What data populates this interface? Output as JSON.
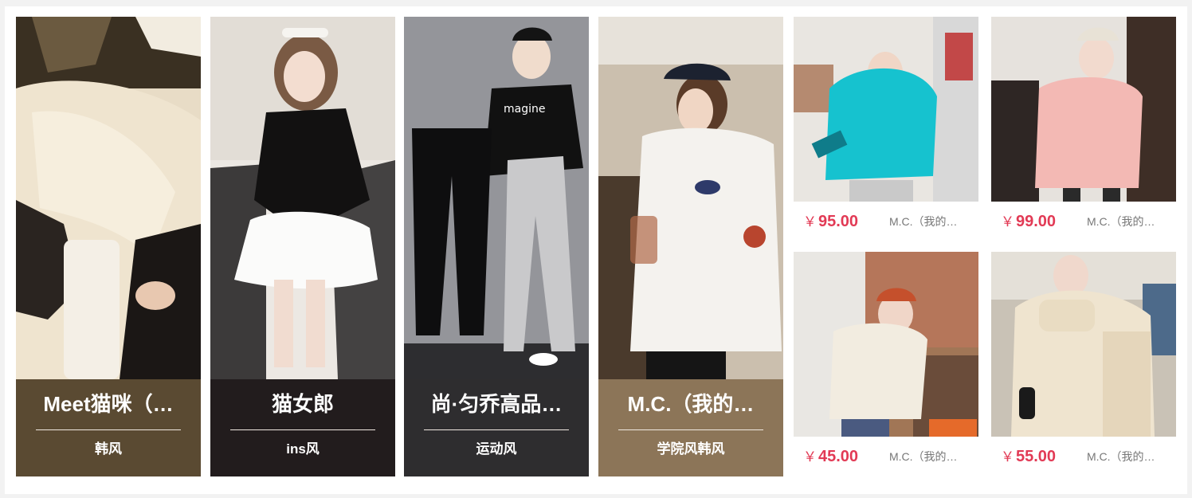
{
  "stores": [
    {
      "name": "Meet猫咪（…",
      "tag": "韩风",
      "color": "#5a4a32"
    },
    {
      "name": "猫女郎",
      "tag": "ins风",
      "color": "#221c1d"
    },
    {
      "name": "尚·匀乔高品…",
      "tag": "运动风",
      "color": "#2e2d2f"
    },
    {
      "name": "M.C.（我的…",
      "tag": "学院风韩风",
      "color": "#8c7558"
    }
  ],
  "products": [
    {
      "currency": "￥",
      "price": "95.00",
      "shop": "M.C.（我的…"
    },
    {
      "currency": "￥",
      "price": "99.00",
      "shop": "M.C.（我的…"
    },
    {
      "currency": "￥",
      "price": "45.00",
      "shop": "M.C.（我的…"
    },
    {
      "currency": "￥",
      "price": "55.00",
      "shop": "M.C.（我的…"
    }
  ],
  "accent_color": "#e23a55"
}
